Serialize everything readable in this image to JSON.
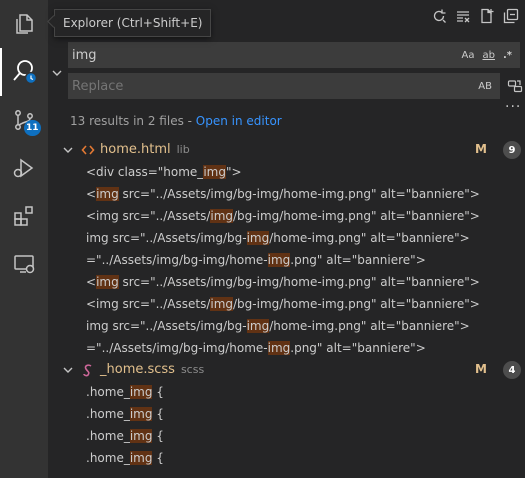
{
  "tooltip": "Explorer (Ctrl+Shift+E)",
  "activity": {
    "scm_badge": "11"
  },
  "search": {
    "query": "img",
    "options": {
      "match_case": "Aa",
      "whole_word": "ab",
      "regex": ".*"
    }
  },
  "replace": {
    "placeholder": "Replace",
    "preserve_case": "AB"
  },
  "summary": {
    "text": "13 results in 2 files - ",
    "link": "Open in editor"
  },
  "files": [
    {
      "name": "home.html",
      "dir": "lib",
      "status": "M",
      "count": "9",
      "matches": [
        {
          "before": "<div class=\"home_",
          "hl": "img",
          "after": "\">"
        },
        {
          "before": "<",
          "hl": "img",
          "after": " src=\"../Assets/img/bg-img/home-img.png\" alt=\"banniere\">"
        },
        {
          "before": "<img src=\"../Assets/",
          "hl": "img",
          "after": "/bg-img/home-img.png\" alt=\"banniere\">"
        },
        {
          "before": "img src=\"../Assets/img/bg-",
          "hl": "img",
          "after": "/home-img.png\" alt=\"banniere\">"
        },
        {
          "before": "=\"../Assets/img/bg-img/home-",
          "hl": "img",
          "after": ".png\" alt=\"banniere\">"
        },
        {
          "before": "<",
          "hl": "img",
          "after": " src=\"../Assets/img/bg-img/home-img.png\" alt=\"banniere\">"
        },
        {
          "before": "<img src=\"../Assets/",
          "hl": "img",
          "after": "/bg-img/home-img.png\" alt=\"banniere\">"
        },
        {
          "before": "img src=\"../Assets/img/bg-",
          "hl": "img",
          "after": "/home-img.png\" alt=\"banniere\">"
        },
        {
          "before": "=\"../Assets/img/bg-img/home-",
          "hl": "img",
          "after": ".png\" alt=\"banniere\">"
        }
      ]
    },
    {
      "name": "_home.scss",
      "dir": "scss",
      "status": "M",
      "count": "4",
      "matches": [
        {
          "before": ".home_",
          "hl": "img",
          "after": " {"
        },
        {
          "before": ".home_",
          "hl": "img",
          "after": " {"
        },
        {
          "before": ".home_",
          "hl": "img",
          "after": " {"
        },
        {
          "before": ".home_",
          "hl": "img",
          "after": " {"
        }
      ]
    }
  ],
  "icons": {
    "explorer": "files-icon",
    "search": "search-icon",
    "scm": "source-control-icon",
    "debug": "run-debug-icon",
    "extensions": "extensions-icon",
    "remote": "remote-explorer-icon",
    "refresh": "refresh-icon",
    "clear": "clear-results-icon",
    "new_search": "new-search-editor-icon",
    "collapse": "collapse-all-icon"
  },
  "colors": {
    "accent": "#0e70c0",
    "link": "#3794ff",
    "modified": "#e2c08d",
    "highlight": "#613214"
  }
}
